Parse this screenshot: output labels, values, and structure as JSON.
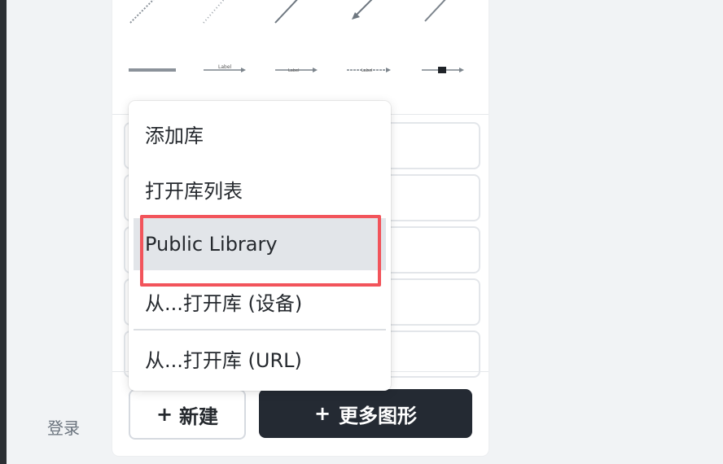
{
  "left_panel": {
    "login_label": "登录"
  },
  "shapes": {
    "row1": [
      "dotted-diagonal-line",
      "dotted-diagonal-line-light",
      "diagonal-line",
      "diagonal-arrow",
      "diagonal-line-thin"
    ],
    "row2": [
      "thick-line",
      "labeled-arrow",
      "labeled-arrow-2",
      "labeled-arrow-3",
      "arrow-with-box"
    ],
    "row2_labels": [
      "Label",
      "Label",
      "Label"
    ]
  },
  "menu": {
    "items": [
      {
        "label": "添加库"
      },
      {
        "label": "打开库列表"
      },
      {
        "label": "Public Library"
      },
      {
        "label": "从...打开库 (设备)"
      },
      {
        "label": "从...打开库 (URL)"
      }
    ]
  },
  "buttons": {
    "new_label": "新建",
    "more_shapes_label": "更多图形",
    "plus": "+"
  },
  "colors": {
    "dark_button": "#242a33",
    "highlight": "#f2545b",
    "active_menu_bg": "#e2e5e9"
  }
}
